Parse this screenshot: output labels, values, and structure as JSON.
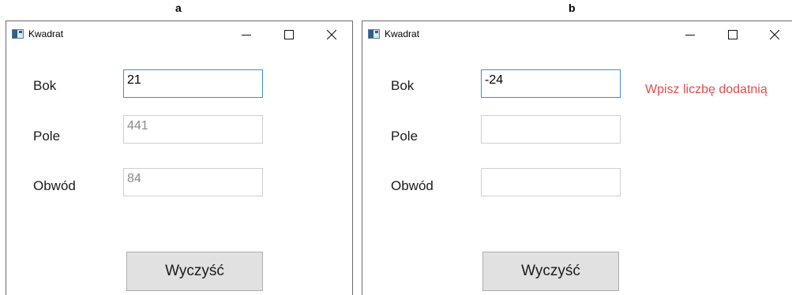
{
  "panels": [
    {
      "caption": "a",
      "window_title": "Kwadrat",
      "labels": {
        "side": "Bok",
        "area": "Pole",
        "perimeter": "Obwód"
      },
      "fields": {
        "side": "21",
        "area": "441",
        "perimeter": "84"
      },
      "button_label": "Wyczyść",
      "error_message": ""
    },
    {
      "caption": "b",
      "window_title": "Kwadrat",
      "labels": {
        "side": "Bok",
        "area": "Pole",
        "perimeter": "Obwód"
      },
      "fields": {
        "side": "-24",
        "area": "",
        "perimeter": ""
      },
      "button_label": "Wyczyść",
      "error_message": "Wpisz liczbę dodatnią"
    }
  ],
  "window_controls": [
    "minimize-icon",
    "maximize-icon",
    "close-icon"
  ],
  "colors": {
    "focus_border": "#3c8fd8",
    "error_text": "#e84a4a",
    "button_face": "#e1e1e1",
    "readonly_text": "#8a8a8a"
  }
}
